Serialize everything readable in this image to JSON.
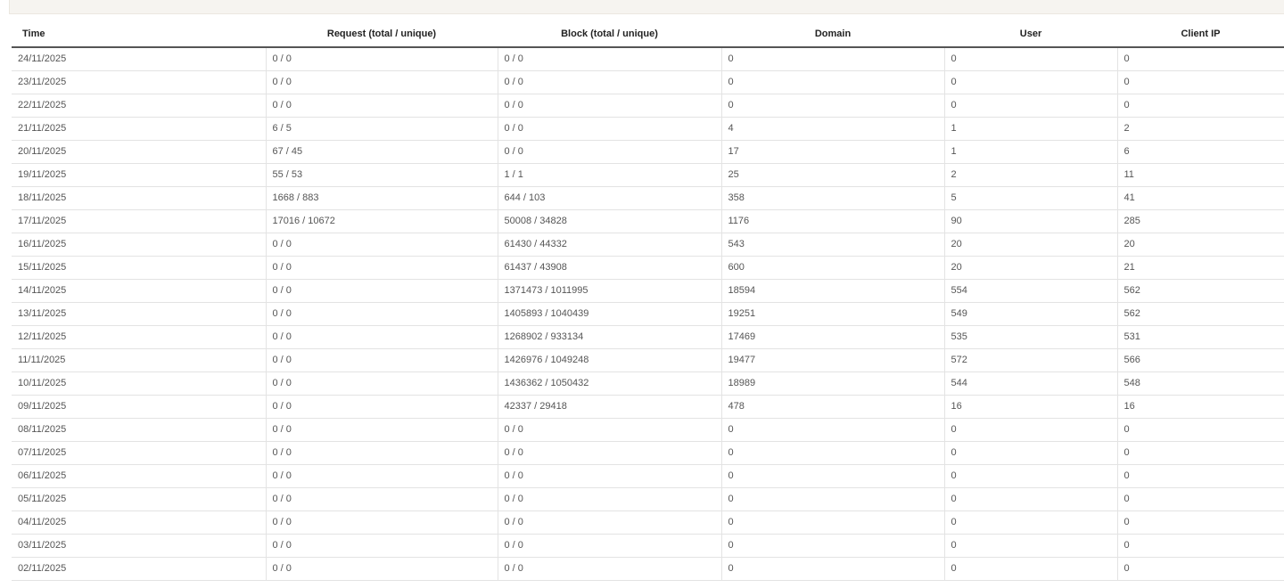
{
  "table": {
    "headers": [
      "Time",
      "Request (total / unique)",
      "Block (total / unique)",
      "Domain",
      "User",
      "Client IP"
    ],
    "rows": [
      [
        "24/11/2025",
        "0 / 0",
        "0 / 0",
        "0",
        "0",
        "0"
      ],
      [
        "23/11/2025",
        "0 / 0",
        "0 / 0",
        "0",
        "0",
        "0"
      ],
      [
        "22/11/2025",
        "0 / 0",
        "0 / 0",
        "0",
        "0",
        "0"
      ],
      [
        "21/11/2025",
        "6 / 5",
        "0 / 0",
        "4",
        "1",
        "2"
      ],
      [
        "20/11/2025",
        "67 / 45",
        "0 / 0",
        "17",
        "1",
        "6"
      ],
      [
        "19/11/2025",
        "55 / 53",
        "1 / 1",
        "25",
        "2",
        "11"
      ],
      [
        "18/11/2025",
        "1668 / 883",
        "644 / 103",
        "358",
        "5",
        "41"
      ],
      [
        "17/11/2025",
        "17016 / 10672",
        "50008 / 34828",
        "1176",
        "90",
        "285"
      ],
      [
        "16/11/2025",
        "0 / 0",
        "61430 / 44332",
        "543",
        "20",
        "20"
      ],
      [
        "15/11/2025",
        "0 / 0",
        "61437 / 43908",
        "600",
        "20",
        "21"
      ],
      [
        "14/11/2025",
        "0 / 0",
        "1371473 / 1011995",
        "18594",
        "554",
        "562"
      ],
      [
        "13/11/2025",
        "0 / 0",
        "1405893 / 1040439",
        "19251",
        "549",
        "562"
      ],
      [
        "12/11/2025",
        "0 / 0",
        "1268902 / 933134",
        "17469",
        "535",
        "531"
      ],
      [
        "11/11/2025",
        "0 / 0",
        "1426976 / 1049248",
        "19477",
        "572",
        "566"
      ],
      [
        "10/11/2025",
        "0 / 0",
        "1436362 / 1050432",
        "18989",
        "544",
        "548"
      ],
      [
        "09/11/2025",
        "0 / 0",
        "42337 / 29418",
        "478",
        "16",
        "16"
      ],
      [
        "08/11/2025",
        "0 / 0",
        "0 / 0",
        "0",
        "0",
        "0"
      ],
      [
        "07/11/2025",
        "0 / 0",
        "0 / 0",
        "0",
        "0",
        "0"
      ],
      [
        "06/11/2025",
        "0 / 0",
        "0 / 0",
        "0",
        "0",
        "0"
      ],
      [
        "05/11/2025",
        "0 / 0",
        "0 / 0",
        "0",
        "0",
        "0"
      ],
      [
        "04/11/2025",
        "0 / 0",
        "0 / 0",
        "0",
        "0",
        "0"
      ],
      [
        "03/11/2025",
        "0 / 0",
        "0 / 0",
        "0",
        "0",
        "0"
      ],
      [
        "02/11/2025",
        "0 / 0",
        "0 / 0",
        "0",
        "0",
        "0"
      ]
    ]
  },
  "colors": {
    "banner_bg": "#f6f4f0",
    "header_rule": "#555555",
    "row_border": "#e3e3e3",
    "cell_text": "#555555"
  }
}
